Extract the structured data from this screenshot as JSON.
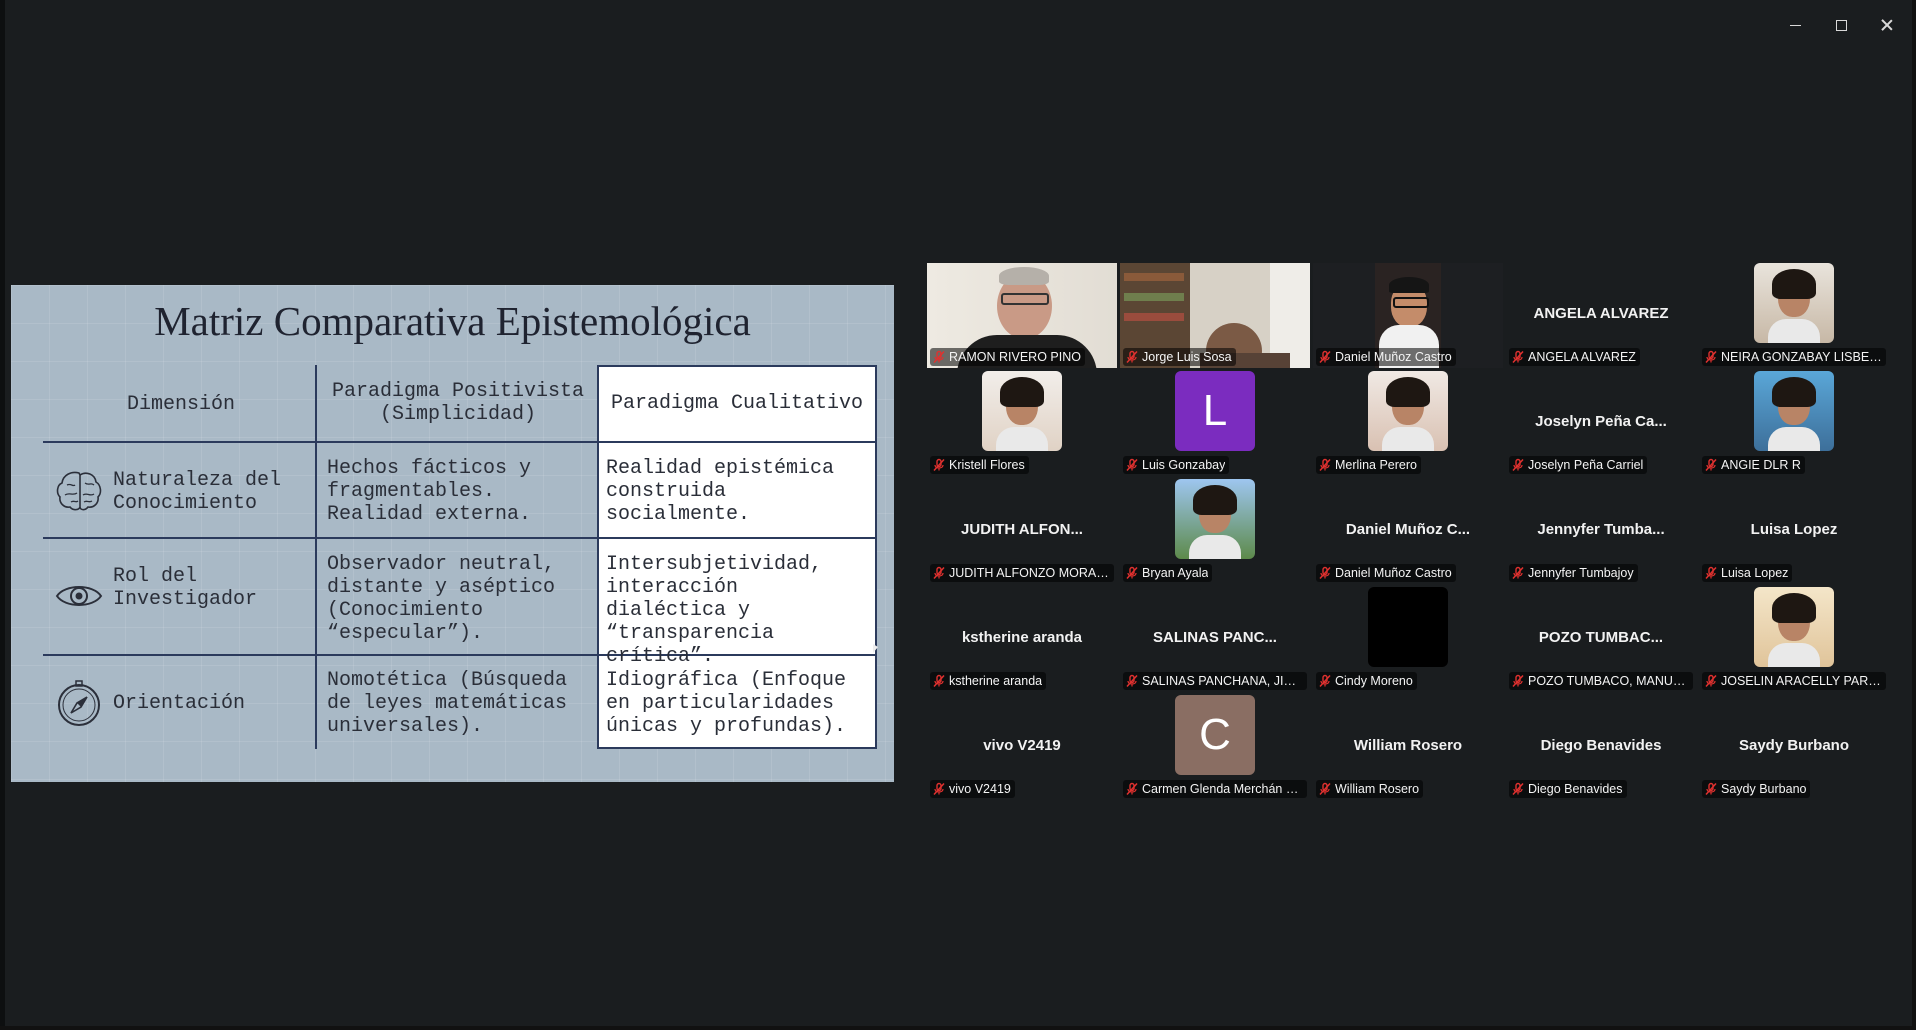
{
  "slide": {
    "title": "Matriz Comparativa Epistemológica",
    "headers": {
      "dimension": "Dimensión",
      "positivist": "Paradigma Positivista (Simplicidad)",
      "qualitative": "Paradigma Cualitativo"
    },
    "rows": [
      {
        "icon": "brain-icon",
        "dimension": "Naturaleza del Conocimiento",
        "positivist": "Hechos fácticos y fragmentables. Realidad externa.",
        "qualitative": "Realidad epistémica construida socialmente."
      },
      {
        "icon": "eye-icon",
        "dimension": "Rol del Investigador",
        "positivist": "Observador neutral, distante y aséptico (Conocimiento “especular”).",
        "qualitative": "Intersubjetividad, interacción dialéctica y “transparencia crítica”."
      },
      {
        "icon": "compass-icon",
        "dimension": "Orientación",
        "positivist": "Nomotética (Búsqueda de leyes matemáticas universales).",
        "qualitative": "Idiográfica (Enfoque en particularidades únicas y profundas)."
      }
    ]
  },
  "participants": [
    {
      "name": "RAMON RIVERO PINO",
      "kind": "video",
      "muted": true
    },
    {
      "name": "Jorge Luis Sosa",
      "kind": "video",
      "muted": true
    },
    {
      "name": "Daniel Muñoz Castro",
      "kind": "video",
      "muted": true,
      "active_speaker": true
    },
    {
      "name": "ANGELA ALVAREZ",
      "display": "ANGELA ALVAREZ",
      "kind": "name",
      "muted": true
    },
    {
      "name": "NEIRA GONZABAY LISBETH",
      "kind": "photo",
      "muted": true
    },
    {
      "name": "Kristell Flores",
      "kind": "photo",
      "muted": true
    },
    {
      "name": "Luis Gonzabay",
      "kind": "avatar",
      "initial": "L",
      "color": "#7b2cbf",
      "muted": true
    },
    {
      "name": "Merlina Perero",
      "kind": "photo",
      "muted": true
    },
    {
      "name": "Joselyn Peña Carriel",
      "display": "Joselyn Peña Ca...",
      "kind": "name",
      "muted": true
    },
    {
      "name": "ANGIE DLR R",
      "kind": "photo",
      "muted": true
    },
    {
      "name": "JUDITH ALFONZO MORALES",
      "display": "JUDITH ALFON...",
      "kind": "name",
      "muted": true
    },
    {
      "name": "Bryan Ayala",
      "kind": "photo",
      "muted": true
    },
    {
      "name": "Daniel Muñoz Castro",
      "display": "Daniel Muñoz C...",
      "kind": "name",
      "muted": true
    },
    {
      "name": "Jennyfer Tumbajoy",
      "display": "Jennyfer Tumba...",
      "kind": "name",
      "muted": true
    },
    {
      "name": "Luisa Lopez",
      "display": "Luisa Lopez",
      "kind": "name",
      "muted": true
    },
    {
      "name": "kstherine aranda",
      "display": "kstherine aranda",
      "kind": "name",
      "muted": true
    },
    {
      "name": "SALINAS PANCHANA, JIMP...",
      "display": "SALINAS PANC...",
      "kind": "name",
      "muted": true
    },
    {
      "name": "Cindy Moreno",
      "kind": "black",
      "muted": true
    },
    {
      "name": "POZO TUMBACO, MANUEL...",
      "display": "POZO TUMBAC...",
      "kind": "name",
      "muted": true
    },
    {
      "name": "JOSELIN ARACELLY PARRAL...",
      "kind": "photo",
      "muted": true
    },
    {
      "name": "vivo V2419",
      "display": "vivo V2419",
      "kind": "name",
      "muted": true
    },
    {
      "name": "Carmen Glenda Merchán B...",
      "kind": "avatar",
      "initial": "C",
      "color": "#8a6e63",
      "muted": true
    },
    {
      "name": "William Rosero",
      "display": "William Rosero",
      "kind": "name",
      "muted": true
    },
    {
      "name": "Diego Benavides",
      "display": "Diego Benavides",
      "kind": "name",
      "muted": true
    },
    {
      "name": "Saydy Burbano",
      "display": "Saydy Burbano",
      "kind": "name",
      "muted": true
    }
  ],
  "colors": {
    "background": "#1a1d1f",
    "active_speaker_border": "#1fd183",
    "mute_icon": "#e0312f"
  }
}
